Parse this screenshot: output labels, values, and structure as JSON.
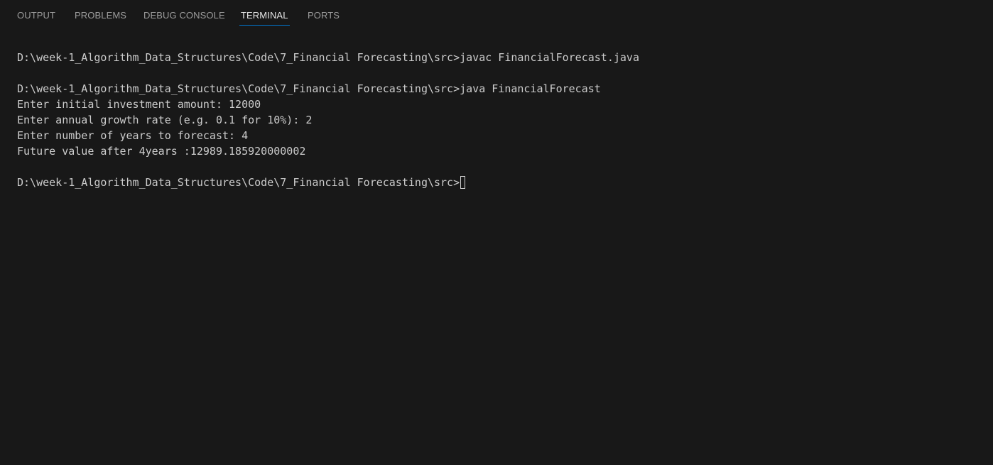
{
  "tabs": [
    {
      "label": "OUTPUT",
      "active": false
    },
    {
      "label": "PROBLEMS",
      "active": false
    },
    {
      "label": "DEBUG CONSOLE",
      "active": false
    },
    {
      "label": "TERMINAL",
      "active": true
    },
    {
      "label": "PORTS",
      "active": false
    }
  ],
  "terminal": {
    "lines": [
      "",
      "D:\\week-1_Algorithm_Data_Structures\\Code\\7_Financial Forecasting\\src>javac FinancialForecast.java",
      "",
      "D:\\week-1_Algorithm_Data_Structures\\Code\\7_Financial Forecasting\\src>java FinancialForecast",
      "Enter initial investment amount: 12000",
      "Enter annual growth rate (e.g. 0.1 for 10%): 2",
      "Enter number of years to forecast: 4",
      "Future value after 4years :12989.185920000002",
      "",
      "D:\\week-1_Algorithm_Data_Structures\\Code\\7_Financial Forecasting\\src>"
    ]
  },
  "colors": {
    "background": "#181818",
    "text": "#cccccc",
    "active_tab_border": "#0078d4"
  }
}
